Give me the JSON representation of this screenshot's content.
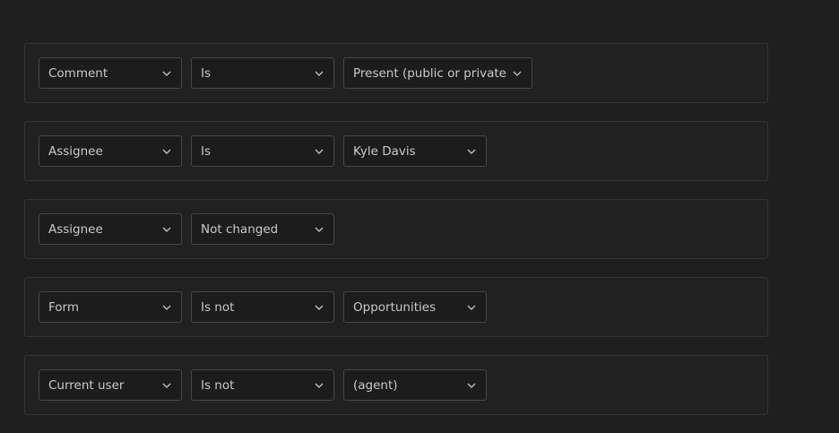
{
  "conditions": [
    {
      "field": "Comment",
      "operator": "Is",
      "value": "Present (public or private)"
    },
    {
      "field": "Assignee",
      "operator": "Is",
      "value": "Kyle Davis"
    },
    {
      "field": "Assignee",
      "operator": "Not changed"
    },
    {
      "field": "Form",
      "operator": "Is not",
      "value": "Opportunities"
    },
    {
      "field": "Current user",
      "operator": "Is not",
      "value": "(agent)"
    }
  ],
  "icons": {
    "dropdown": "chevron-down-icon"
  },
  "colors": {
    "background": "#1f1f1f",
    "row_border": "#343434",
    "select_border": "#474747",
    "text": "#c9c9c9"
  }
}
